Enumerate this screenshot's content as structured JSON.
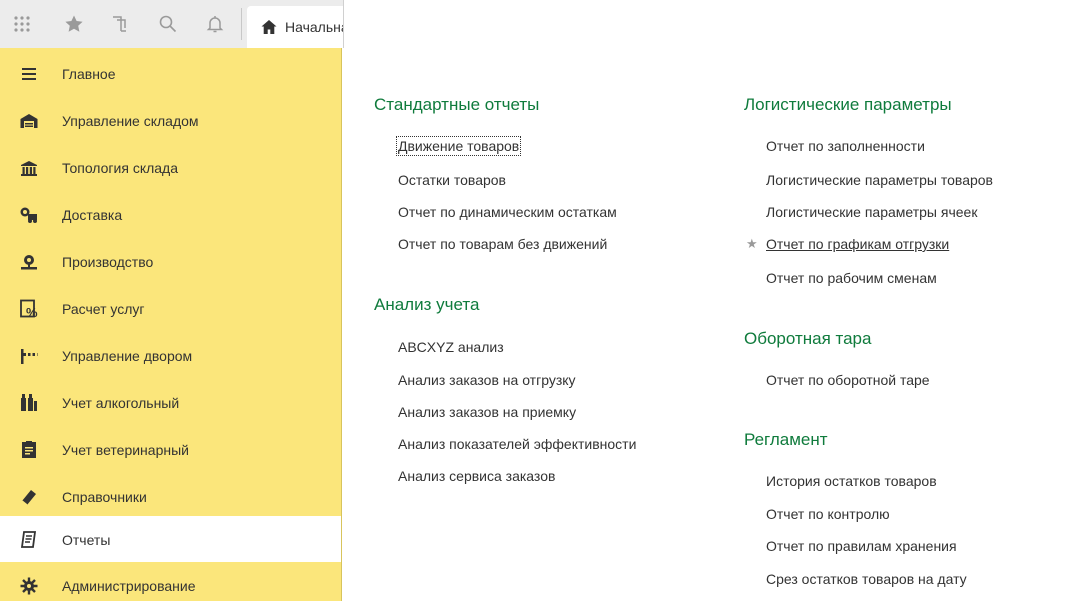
{
  "topbar": {
    "icons": [
      "apps-grid-icon",
      "star-icon",
      "history-icon",
      "search-icon",
      "bell-icon"
    ],
    "home_tab_label": "Начальная страница"
  },
  "sidebar": {
    "items": [
      {
        "label": "Главное",
        "icon": "menu-lines-icon"
      },
      {
        "label": "Управление складом",
        "icon": "warehouse-icon"
      },
      {
        "label": "Топология склада",
        "icon": "building-icon"
      },
      {
        "label": "Доставка",
        "icon": "truck-icon"
      },
      {
        "label": "Производство",
        "icon": "factory-icon"
      },
      {
        "label": "Расчет услуг",
        "icon": "percent-doc-icon"
      },
      {
        "label": "Управление двором",
        "icon": "barrier-icon"
      },
      {
        "label": "Учет алкогольный",
        "icon": "bottles-icon"
      },
      {
        "label": "Учет ветеринарный",
        "icon": "vet-doc-icon"
      },
      {
        "label": "Справочники",
        "icon": "book-icon"
      },
      {
        "label": "Отчеты",
        "icon": "reports-icon",
        "active": true
      },
      {
        "label": "Администрирование",
        "icon": "gear-icon"
      }
    ]
  },
  "content": {
    "left": {
      "sections": [
        {
          "title": "Стандартные отчеты",
          "links": [
            "Движение товаров",
            "Остатки товаров",
            "Отчет по динамическим остаткам",
            "Отчет по товарам без движений"
          ]
        },
        {
          "title": "Анализ учета",
          "links": [
            "ABCXYZ анализ",
            "Анализ заказов на отгрузку",
            "Анализ заказов на приемку",
            "Анализ показателей эффективности",
            "Анализ сервиса заказов"
          ]
        }
      ]
    },
    "right": {
      "sections": [
        {
          "title": "Логистические параметры",
          "links": [
            "Отчет по заполненности",
            "Логистические параметры товаров",
            "Логистические параметры ячеек",
            "Отчет по графикам отгрузки",
            "Отчет по рабочим сменам"
          ]
        },
        {
          "title": "Оборотная тара",
          "links": [
            "Отчет по оборотной таре"
          ]
        },
        {
          "title": "Регламент",
          "links": [
            "История остатков товаров",
            "Отчет по контролю",
            "Отчет по правилам хранения",
            "Срез остатков товаров на дату"
          ]
        }
      ]
    }
  }
}
